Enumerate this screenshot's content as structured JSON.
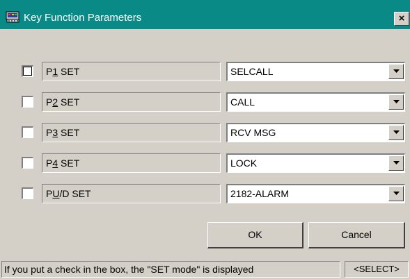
{
  "window": {
    "title": "Key Function Parameters",
    "close_glyph": "×",
    "icon": "app-keyboard-icon",
    "titlebar_color": "#0a8a86"
  },
  "params": [
    {
      "label_pre": "P",
      "label_key": "1",
      "label_post": " SET",
      "checked": false,
      "value": "SELCALL"
    },
    {
      "label_pre": "P",
      "label_key": "2",
      "label_post": " SET",
      "checked": false,
      "value": "CALL"
    },
    {
      "label_pre": "P",
      "label_key": "3",
      "label_post": " SET",
      "checked": false,
      "value": "RCV MSG"
    },
    {
      "label_pre": "P",
      "label_key": "4",
      "label_post": " SET",
      "checked": false,
      "value": "LOCK"
    },
    {
      "label_pre": "P",
      "label_key": "U",
      "label_post": "/D SET",
      "checked": false,
      "value": "2182-ALARM"
    }
  ],
  "buttons": {
    "ok": "OK",
    "cancel": "Cancel"
  },
  "status": {
    "message": "If you put a check in the box, the \"SET mode\" is displayed",
    "mode": "<SELECT>"
  }
}
